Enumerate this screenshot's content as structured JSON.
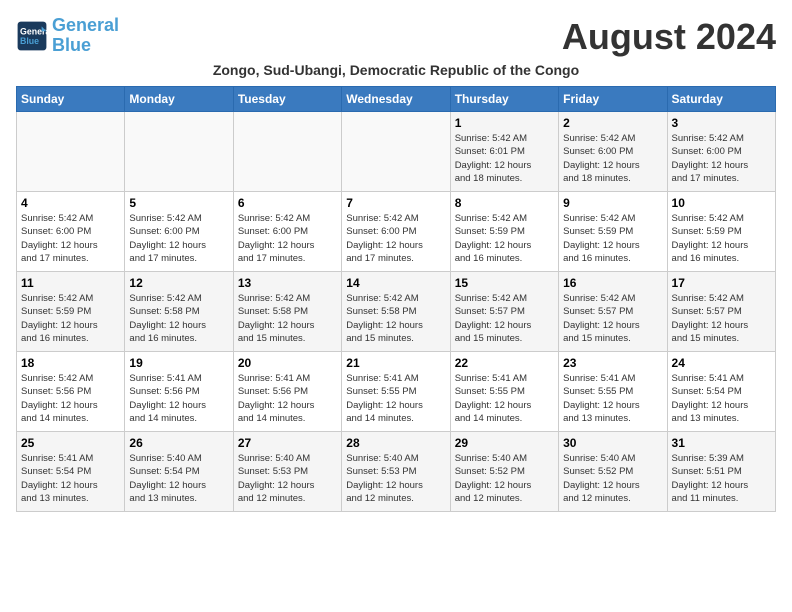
{
  "header": {
    "logo_line1": "General",
    "logo_line2": "Blue",
    "month_title": "August 2024",
    "subtitle": "Zongo, Sud-Ubangi, Democratic Republic of the Congo"
  },
  "weekdays": [
    "Sunday",
    "Monday",
    "Tuesday",
    "Wednesday",
    "Thursday",
    "Friday",
    "Saturday"
  ],
  "weeks": [
    [
      {
        "day": "",
        "info": ""
      },
      {
        "day": "",
        "info": ""
      },
      {
        "day": "",
        "info": ""
      },
      {
        "day": "",
        "info": ""
      },
      {
        "day": "1",
        "info": "Sunrise: 5:42 AM\nSunset: 6:01 PM\nDaylight: 12 hours\nand 18 minutes."
      },
      {
        "day": "2",
        "info": "Sunrise: 5:42 AM\nSunset: 6:00 PM\nDaylight: 12 hours\nand 18 minutes."
      },
      {
        "day": "3",
        "info": "Sunrise: 5:42 AM\nSunset: 6:00 PM\nDaylight: 12 hours\nand 17 minutes."
      }
    ],
    [
      {
        "day": "4",
        "info": "Sunrise: 5:42 AM\nSunset: 6:00 PM\nDaylight: 12 hours\nand 17 minutes."
      },
      {
        "day": "5",
        "info": "Sunrise: 5:42 AM\nSunset: 6:00 PM\nDaylight: 12 hours\nand 17 minutes."
      },
      {
        "day": "6",
        "info": "Sunrise: 5:42 AM\nSunset: 6:00 PM\nDaylight: 12 hours\nand 17 minutes."
      },
      {
        "day": "7",
        "info": "Sunrise: 5:42 AM\nSunset: 6:00 PM\nDaylight: 12 hours\nand 17 minutes."
      },
      {
        "day": "8",
        "info": "Sunrise: 5:42 AM\nSunset: 5:59 PM\nDaylight: 12 hours\nand 16 minutes."
      },
      {
        "day": "9",
        "info": "Sunrise: 5:42 AM\nSunset: 5:59 PM\nDaylight: 12 hours\nand 16 minutes."
      },
      {
        "day": "10",
        "info": "Sunrise: 5:42 AM\nSunset: 5:59 PM\nDaylight: 12 hours\nand 16 minutes."
      }
    ],
    [
      {
        "day": "11",
        "info": "Sunrise: 5:42 AM\nSunset: 5:59 PM\nDaylight: 12 hours\nand 16 minutes."
      },
      {
        "day": "12",
        "info": "Sunrise: 5:42 AM\nSunset: 5:58 PM\nDaylight: 12 hours\nand 16 minutes."
      },
      {
        "day": "13",
        "info": "Sunrise: 5:42 AM\nSunset: 5:58 PM\nDaylight: 12 hours\nand 15 minutes."
      },
      {
        "day": "14",
        "info": "Sunrise: 5:42 AM\nSunset: 5:58 PM\nDaylight: 12 hours\nand 15 minutes."
      },
      {
        "day": "15",
        "info": "Sunrise: 5:42 AM\nSunset: 5:57 PM\nDaylight: 12 hours\nand 15 minutes."
      },
      {
        "day": "16",
        "info": "Sunrise: 5:42 AM\nSunset: 5:57 PM\nDaylight: 12 hours\nand 15 minutes."
      },
      {
        "day": "17",
        "info": "Sunrise: 5:42 AM\nSunset: 5:57 PM\nDaylight: 12 hours\nand 15 minutes."
      }
    ],
    [
      {
        "day": "18",
        "info": "Sunrise: 5:42 AM\nSunset: 5:56 PM\nDaylight: 12 hours\nand 14 minutes."
      },
      {
        "day": "19",
        "info": "Sunrise: 5:41 AM\nSunset: 5:56 PM\nDaylight: 12 hours\nand 14 minutes."
      },
      {
        "day": "20",
        "info": "Sunrise: 5:41 AM\nSunset: 5:56 PM\nDaylight: 12 hours\nand 14 minutes."
      },
      {
        "day": "21",
        "info": "Sunrise: 5:41 AM\nSunset: 5:55 PM\nDaylight: 12 hours\nand 14 minutes."
      },
      {
        "day": "22",
        "info": "Sunrise: 5:41 AM\nSunset: 5:55 PM\nDaylight: 12 hours\nand 14 minutes."
      },
      {
        "day": "23",
        "info": "Sunrise: 5:41 AM\nSunset: 5:55 PM\nDaylight: 12 hours\nand 13 minutes."
      },
      {
        "day": "24",
        "info": "Sunrise: 5:41 AM\nSunset: 5:54 PM\nDaylight: 12 hours\nand 13 minutes."
      }
    ],
    [
      {
        "day": "25",
        "info": "Sunrise: 5:41 AM\nSunset: 5:54 PM\nDaylight: 12 hours\nand 13 minutes."
      },
      {
        "day": "26",
        "info": "Sunrise: 5:40 AM\nSunset: 5:54 PM\nDaylight: 12 hours\nand 13 minutes."
      },
      {
        "day": "27",
        "info": "Sunrise: 5:40 AM\nSunset: 5:53 PM\nDaylight: 12 hours\nand 12 minutes."
      },
      {
        "day": "28",
        "info": "Sunrise: 5:40 AM\nSunset: 5:53 PM\nDaylight: 12 hours\nand 12 minutes."
      },
      {
        "day": "29",
        "info": "Sunrise: 5:40 AM\nSunset: 5:52 PM\nDaylight: 12 hours\nand 12 minutes."
      },
      {
        "day": "30",
        "info": "Sunrise: 5:40 AM\nSunset: 5:52 PM\nDaylight: 12 hours\nand 12 minutes."
      },
      {
        "day": "31",
        "info": "Sunrise: 5:39 AM\nSunset: 5:51 PM\nDaylight: 12 hours\nand 11 minutes."
      }
    ]
  ]
}
